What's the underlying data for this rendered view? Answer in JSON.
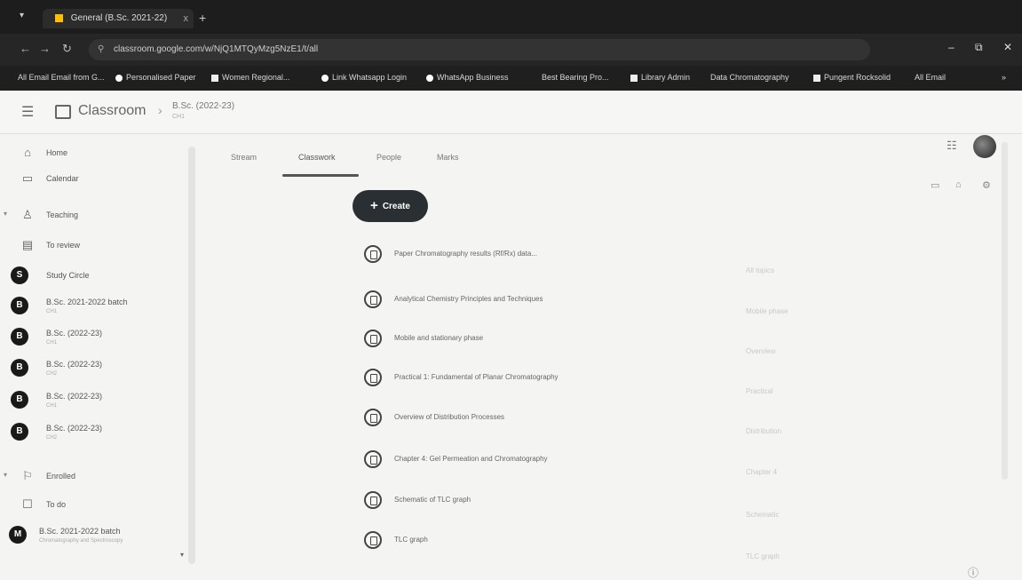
{
  "browser": {
    "tab_title": "General (B.Sc. 2021-22)",
    "tab_close": "x",
    "new_tab": "+",
    "url": "classroom.google.com/w/NjQ1MTQyMzg5NzE1/t/all",
    "bookmarks": [
      "All Email Email from G...",
      "Personalised Paper",
      "Women Regional...",
      "Link Whatsapp Login",
      "WhatsApp Business",
      "Best Bearing Pro...",
      "Library Admin",
      "Data Chromatography",
      "Pungent Rocksolid",
      "All Email"
    ],
    "bookmarks_overflow": "»"
  },
  "app": {
    "brand": "Classroom",
    "breadcrumb_title": "B.Sc. (2022-23)",
    "breadcrumb_sub": "CH1"
  },
  "sidebar": {
    "items": [
      {
        "label": "Home",
        "icon": "home-icon"
      },
      {
        "label": "Calendar",
        "icon": "calendar-icon"
      },
      {
        "label": "Teaching",
        "icon": "people-icon"
      },
      {
        "label": "To review",
        "icon": "folder-icon"
      },
      {
        "label": "Study Circle",
        "sub": "",
        "avatar": "S"
      },
      {
        "label": "B.Sc. 2021-2022 batch",
        "sub": "CH1",
        "avatar": "B"
      },
      {
        "label": "B.Sc. (2022-23)",
        "sub": "CH1",
        "avatar": "B"
      },
      {
        "label": "B.Sc. (2022-23)",
        "sub": "CH2",
        "avatar": "B"
      },
      {
        "label": "B.Sc. (2022-23)",
        "sub": "CH1",
        "avatar": "B"
      },
      {
        "label": "B.Sc. (2022-23)",
        "sub": "CH2",
        "avatar": "B"
      },
      {
        "label": "Enrolled",
        "icon": "school-icon"
      },
      {
        "label": "To do",
        "icon": "todo-icon"
      },
      {
        "label": "B.Sc. 2021-2022 batch",
        "sub": "Chromatography and Spectroscopy",
        "avatar": "M"
      }
    ]
  },
  "tabs": [
    "Stream",
    "Classwork",
    "People",
    "Marks"
  ],
  "create_button": {
    "plus": "+",
    "label": "Create"
  },
  "topics": [
    "Paper Chromatography results (Rf/Rx) data...",
    "Analytical Chemistry Principles and Techniques",
    "Mobile and stationary phase",
    "Practical 1: Fundamental of Planar Chromatography",
    "Overview of Distribution Processes",
    "Chapter 4: Gel Permeation and Chromatography",
    "Schematic of TLC graph",
    "TLC graph"
  ],
  "right_column": [
    "All topics",
    "Mobile phase",
    "Overview",
    "Practical",
    "Distribution",
    "Chapter 4",
    "Schematic",
    "TLC graph"
  ]
}
